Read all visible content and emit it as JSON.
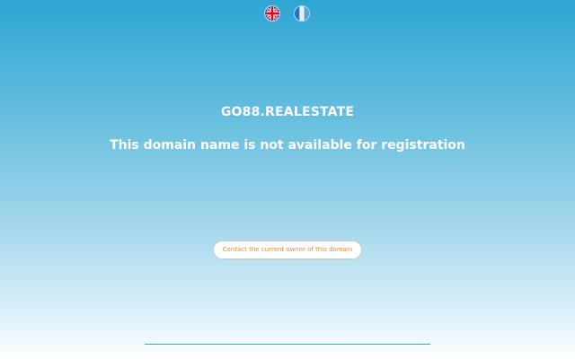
{
  "languages": [
    {
      "code": "en",
      "icon": "uk-flag-icon"
    },
    {
      "code": "fr",
      "icon": "france-flag-icon"
    }
  ],
  "domain": {
    "name": "GO88.REALESTATE",
    "status_message": "This domain name is not available for registration"
  },
  "contact_button": {
    "label": "Contact the current owner of this domain"
  },
  "colors": {
    "gradient_top": "#2ea6d4",
    "gradient_bottom": "#ffffff",
    "button_text": "#f08a2c",
    "divider": "#3ea6d8"
  }
}
